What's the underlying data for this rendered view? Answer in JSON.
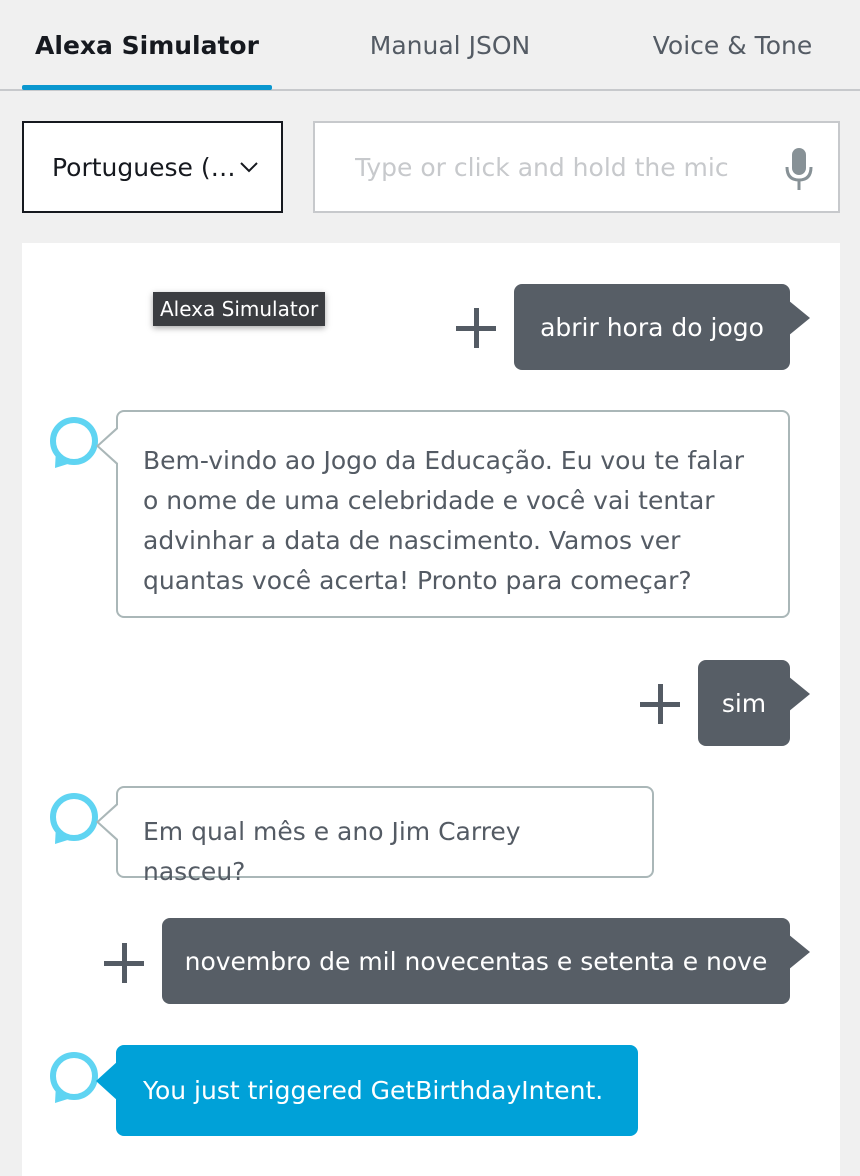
{
  "tabs": {
    "items": [
      {
        "label": "Alexa Simulator"
      },
      {
        "label": "Manual JSON"
      },
      {
        "label": "Voice & Tone"
      }
    ],
    "active": "Alexa Simulator"
  },
  "language_select": {
    "value": "Portuguese (…"
  },
  "utterance_input": {
    "placeholder": "Type or click and hold the mic",
    "value": ""
  },
  "tooltip": {
    "text": "Alexa Simulator"
  },
  "conversation": {
    "user_1": "abrir hora do jogo",
    "alexa_1": "Bem-vindo ao Jogo da Educação. Eu vou te falar o nome de uma celebridade e você vai tentar advinhar a data de nascimento. Vamos ver quantas você acerta! Pronto para começar?",
    "user_2": "sim",
    "alexa_2": "Em qual mês e ano Jim Carrey nasceu?",
    "user_3": "novembro de mil novecentas e setenta e nove",
    "alexa_3": "You just triggered GetBirthdayIntent."
  },
  "icons": {
    "alexa": "alexa-ring-icon",
    "add": "plus-icon",
    "mic": "microphone-icon",
    "dropdown": "chevron-down-icon"
  },
  "colors": {
    "accent": "#0a97cf",
    "alexa_ring": "#5fd4f2",
    "user_bubble": "#575e66",
    "intent_bubble": "#00a1d8"
  }
}
